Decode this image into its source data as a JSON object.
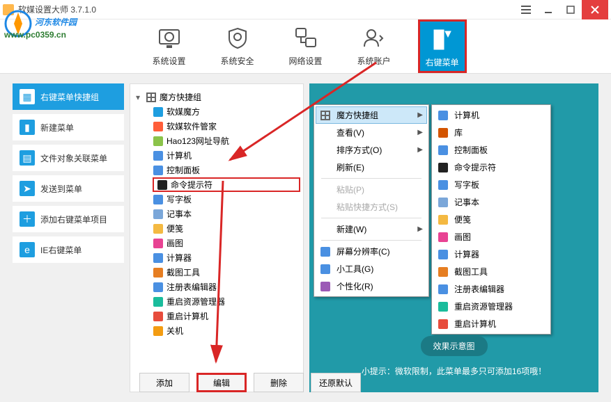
{
  "app": {
    "title": "软媒设置大师 3.7.1.0"
  },
  "watermark": {
    "line1": "河东软件园",
    "line2": "www.pc0359.cn"
  },
  "toolbar": [
    {
      "id": "sys-settings",
      "label": "系统设置"
    },
    {
      "id": "sys-security",
      "label": "系统安全"
    },
    {
      "id": "net-settings",
      "label": "网络设置"
    },
    {
      "id": "sys-account",
      "label": "系统账户"
    },
    {
      "id": "context-menu",
      "label": "右键菜单",
      "active": true
    }
  ],
  "sidebar": [
    {
      "id": "shortcut-group",
      "label": "右键菜单快捷组",
      "icon": "▦",
      "active": true
    },
    {
      "id": "new-menu",
      "label": "新建菜单",
      "icon": "▮"
    },
    {
      "id": "file-assoc",
      "label": "文件对象关联菜单",
      "icon": "▤"
    },
    {
      "id": "send-to",
      "label": "发送到菜单",
      "icon": "➤"
    },
    {
      "id": "add-item",
      "label": "添加右键菜单项目",
      "icon": "＋"
    },
    {
      "id": "ie-menu",
      "label": "IE右键菜单",
      "icon": "e"
    }
  ],
  "tree": {
    "root": "魔方快捷组",
    "items": [
      {
        "label": "软媒魔方",
        "color": "#1e9ee0"
      },
      {
        "label": "软媒软件管家",
        "color": "#ff5e3a"
      },
      {
        "label": "Hao123网址导航",
        "color": "#8bc34a"
      },
      {
        "label": "计算机",
        "color": "#4a90e2"
      },
      {
        "label": "控制面板",
        "color": "#4a90e2"
      },
      {
        "label": "命令提示符",
        "color": "#222",
        "highlight": true
      },
      {
        "label": "写字板",
        "color": "#4a90e2"
      },
      {
        "label": "记事本",
        "color": "#7ba7d9"
      },
      {
        "label": "便笺",
        "color": "#f4b942"
      },
      {
        "label": "画图",
        "color": "#e84393"
      },
      {
        "label": "计算器",
        "color": "#4a90e2"
      },
      {
        "label": "截图工具",
        "color": "#e67e22"
      },
      {
        "label": "注册表编辑器",
        "color": "#4a90e2"
      },
      {
        "label": "重启资源管理器",
        "color": "#1abc9c"
      },
      {
        "label": "重启计算机",
        "color": "#e74c3c"
      },
      {
        "label": "关机",
        "color": "#f39c12"
      }
    ]
  },
  "context_left": [
    {
      "label": "魔方快捷组",
      "kind": "grid",
      "hover": true,
      "arrow": true
    },
    {
      "label": "查看(V)",
      "arrow": true
    },
    {
      "label": "排序方式(O)",
      "arrow": true
    },
    {
      "label": "刷新(E)"
    },
    {
      "sep": true
    },
    {
      "label": "粘贴(P)",
      "disabled": true
    },
    {
      "label": "粘贴快捷方式(S)",
      "disabled": true
    },
    {
      "sep": true
    },
    {
      "label": "新建(W)",
      "arrow": true
    },
    {
      "sep": true
    },
    {
      "label": "屏幕分辨率(C)",
      "color": "#4a90e2"
    },
    {
      "label": "小工具(G)",
      "color": "#4a90e2"
    },
    {
      "label": "个性化(R)",
      "color": "#9b59b6"
    }
  ],
  "context_right": [
    {
      "label": "计算机",
      "color": "#4a90e2"
    },
    {
      "label": "库",
      "color": "#d35400"
    },
    {
      "label": "控制面板",
      "color": "#4a90e2"
    },
    {
      "label": "命令提示符",
      "color": "#222"
    },
    {
      "label": "写字板",
      "color": "#4a90e2"
    },
    {
      "label": "记事本",
      "color": "#7ba7d9"
    },
    {
      "label": "便笺",
      "color": "#f4b942"
    },
    {
      "label": "画图",
      "color": "#e84393"
    },
    {
      "label": "计算器",
      "color": "#4a90e2"
    },
    {
      "label": "截图工具",
      "color": "#e67e22"
    },
    {
      "label": "注册表编辑器",
      "color": "#4a90e2"
    },
    {
      "label": "重启资源管理器",
      "color": "#1abc9c"
    },
    {
      "label": "重启计算机",
      "color": "#e74c3c"
    }
  ],
  "demo": {
    "button": "效果示意图",
    "tip": "小提示：微软限制，此菜单最多只可添加16项哦！"
  },
  "buttons": {
    "add": "添加",
    "edit": "编辑",
    "delete": "删除",
    "restore": "还原默认"
  }
}
